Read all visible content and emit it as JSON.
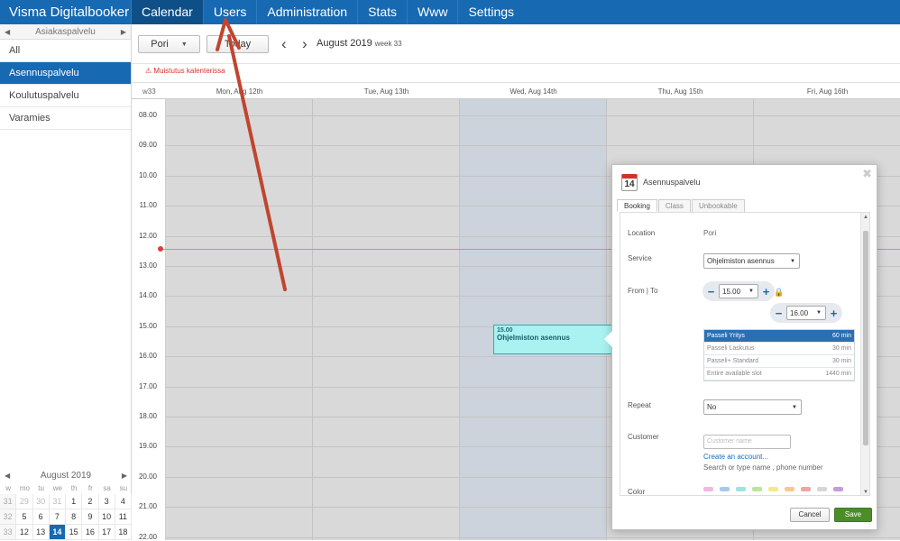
{
  "app": {
    "brand": "Visma Digitalbooker"
  },
  "nav": {
    "items": [
      "Calendar",
      "Users",
      "Administration",
      "Stats",
      "Www",
      "Settings"
    ],
    "active": "Calendar"
  },
  "sidebar": {
    "selector": "Asiakaspalvelu",
    "items": [
      "All",
      "Asennuspalvelu",
      "Koulutuspalvelu",
      "Varamies"
    ],
    "active": "Asennuspalvelu"
  },
  "mini_calendar": {
    "month": "August 2019",
    "dow": [
      "w",
      "mo",
      "tu",
      "we",
      "th",
      "fr",
      "sa",
      "su"
    ],
    "weeks": [
      [
        "31",
        "29",
        "30",
        "31",
        "1",
        "2",
        "3",
        "4"
      ],
      [
        "32",
        "5",
        "6",
        "7",
        "8",
        "9",
        "10",
        "11"
      ],
      [
        "33",
        "12",
        "13",
        "14",
        "15",
        "16",
        "17",
        "18"
      ]
    ],
    "today": "14"
  },
  "toolbar": {
    "location": "Pori",
    "today_label": "Today",
    "period": "August 2019",
    "week": "week 33"
  },
  "reminder": "Muistutus kalenterissa",
  "calendar": {
    "week_label": "w33",
    "days": [
      "Mon, Aug 12th",
      "Tue, Aug 13th",
      "Wed, Aug 14th",
      "Thu, Aug 15th",
      "Fri, Aug 16th"
    ],
    "hours": [
      "08.00",
      "09.00",
      "10.00",
      "11.00",
      "12.00",
      "13.00",
      "14.00",
      "15.00",
      "16.00",
      "17.00",
      "18.00",
      "19.00",
      "20.00",
      "21.00",
      "22.00"
    ],
    "event": {
      "time": "15.00",
      "title": "Ohjelmiston asennus"
    }
  },
  "dialog": {
    "title": "Asennuspalvelu",
    "icon_day": "14",
    "tabs": [
      "Booking",
      "Class",
      "Unbookable"
    ],
    "active_tab": "Booking",
    "location_label": "Location",
    "location_value": "Pori",
    "service_label": "Service",
    "service_value": "Ohjelmiston asennus",
    "fromto_label": "From | To",
    "from_value": "15.00",
    "to_value": "16.00",
    "services": [
      {
        "name": "Passeli Yritys",
        "duration": "60 min"
      },
      {
        "name": "Passeli Laskutus",
        "duration": "30 min"
      },
      {
        "name": "Passeli+ Standard",
        "duration": "30 min"
      },
      {
        "name": "Entire available slot",
        "duration": "1440 min"
      }
    ],
    "repeat_label": "Repeat",
    "repeat_value": "No",
    "customer_label": "Customer",
    "customer_placeholder": "Customer name",
    "create_account": "Create an account...",
    "search_hint": "Search or type name , phone number",
    "color_label": "Color",
    "colors": [
      "#f3b6e6",
      "#a7c8ee",
      "#9ee3e3",
      "#bde59a",
      "#f2ea82",
      "#f7c88e",
      "#f3a3a3",
      "#d6d6d6",
      "#c89ae0"
    ],
    "cancel": "Cancel",
    "save": "Save"
  }
}
